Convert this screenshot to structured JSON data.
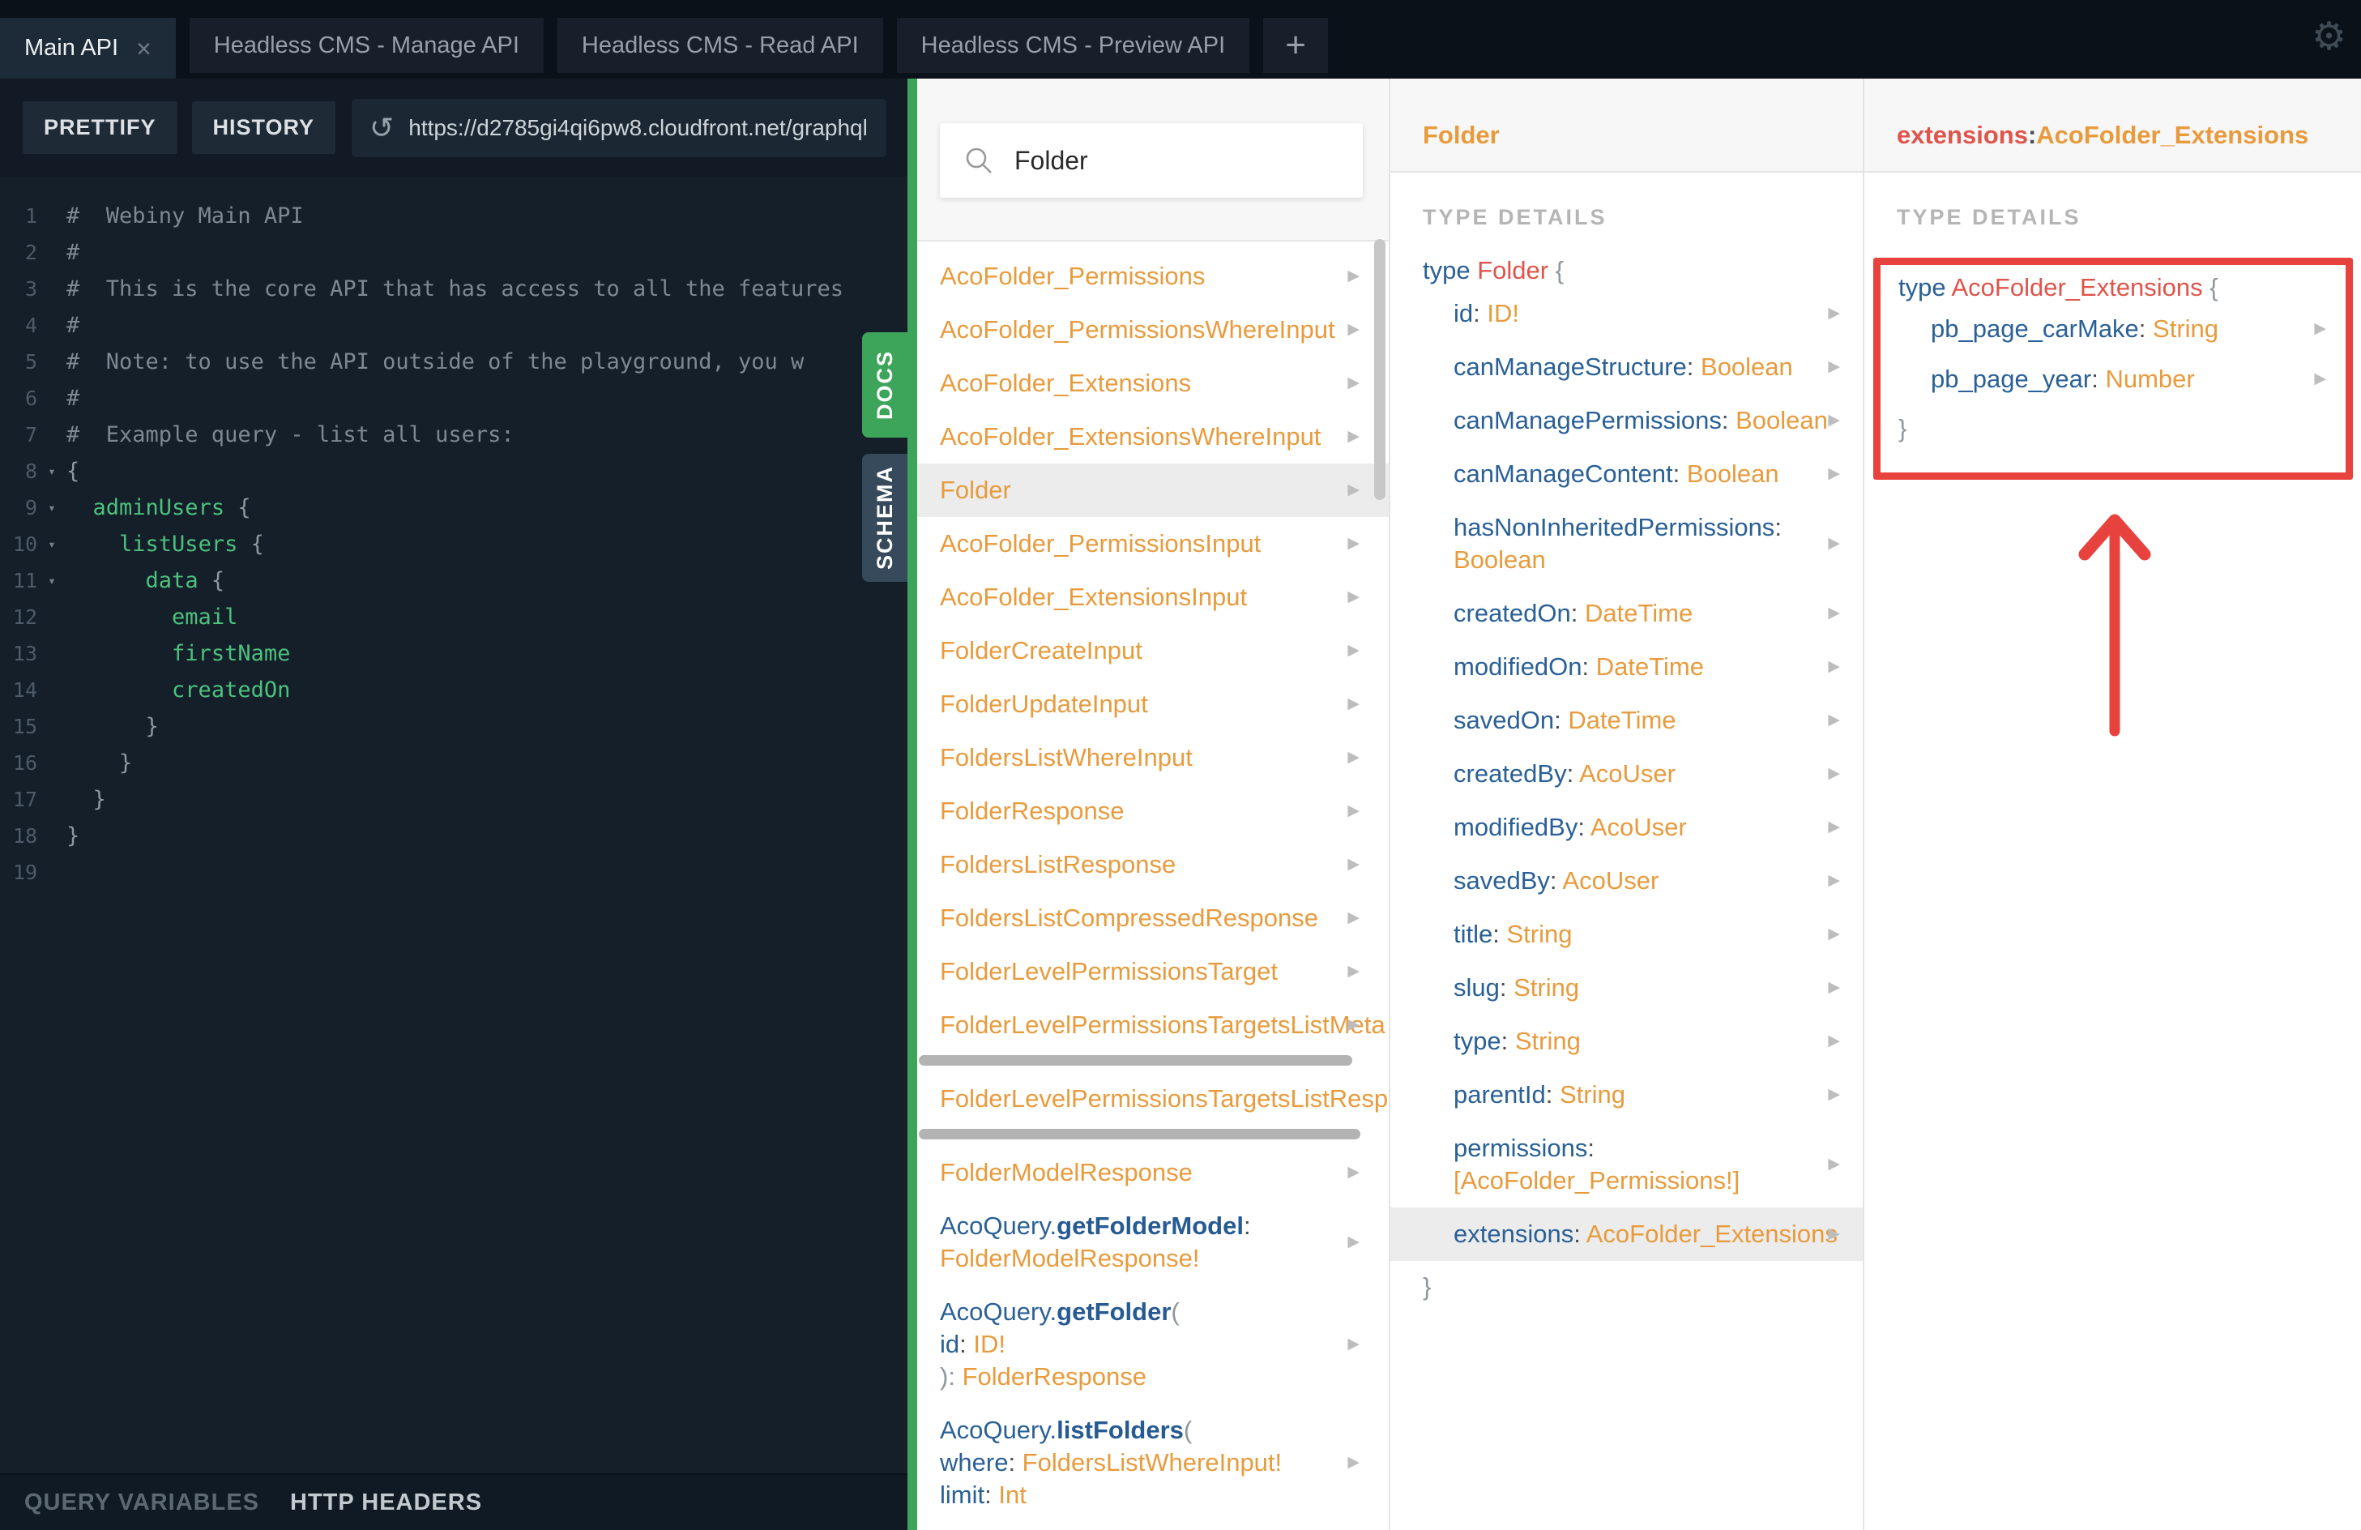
{
  "icons": {
    "gear": "⚙",
    "close": "×",
    "plus": "+",
    "refresh": "↺",
    "fold": "▾",
    "arrow": "▶",
    "search": "search"
  },
  "colors": {
    "accent_green": "#3da55a",
    "schema_tab": "#364a5b",
    "annotation_red": "#e8423e",
    "type_orange": "#e89b3d",
    "field_blue": "#2a6096",
    "type_red": "#df544b",
    "editor_green": "#4cc17e"
  },
  "tabs": {
    "items": [
      {
        "label": "Main API",
        "active": true,
        "closable": true
      },
      {
        "label": "Headless CMS - Manage API",
        "active": false,
        "closable": false
      },
      {
        "label": "Headless CMS - Read API",
        "active": false,
        "closable": false
      },
      {
        "label": "Headless CMS - Preview API",
        "active": false,
        "closable": false
      }
    ],
    "add_label": "+"
  },
  "toolbar": {
    "prettify": "PRETTIFY",
    "history": "HISTORY",
    "url": "https://d2785gi4qi6pw8.cloudfront.net/graphql"
  },
  "side_tabs": {
    "docs": "DOCS",
    "schema": "SCHEMA"
  },
  "footer": {
    "query_variables": "QUERY VARIABLES",
    "http_headers": "HTTP HEADERS"
  },
  "search": {
    "value": "Folder"
  },
  "editor": {
    "lines": [
      {
        "n": "1",
        "fold": false,
        "seg": [
          {
            "t": "#  Webiny Main API",
            "c": "cm"
          }
        ]
      },
      {
        "n": "2",
        "fold": false,
        "seg": [
          {
            "t": "#",
            "c": "cm"
          }
        ]
      },
      {
        "n": "3",
        "fold": false,
        "seg": [
          {
            "t": "#  This is the core API that has access to all the features",
            "c": "cm"
          }
        ]
      },
      {
        "n": "4",
        "fold": false,
        "seg": [
          {
            "t": "#",
            "c": "cm"
          }
        ]
      },
      {
        "n": "5",
        "fold": false,
        "seg": [
          {
            "t": "#  Note: to use the API outside of the playground, you w",
            "c": "cm"
          }
        ]
      },
      {
        "n": "6",
        "fold": false,
        "seg": [
          {
            "t": "#",
            "c": "cm"
          }
        ]
      },
      {
        "n": "7",
        "fold": false,
        "seg": [
          {
            "t": "#  Example query - list all users:",
            "c": "cm"
          }
        ]
      },
      {
        "n": "8",
        "fold": true,
        "seg": [
          {
            "t": "{",
            "c": "pn"
          }
        ]
      },
      {
        "n": "9",
        "fold": true,
        "seg": [
          {
            "t": "  ",
            "c": "pn"
          },
          {
            "t": "adminUsers ",
            "c": "gn"
          },
          {
            "t": "{",
            "c": "pn"
          }
        ]
      },
      {
        "n": "10",
        "fold": true,
        "seg": [
          {
            "t": "    ",
            "c": "pn"
          },
          {
            "t": "listUsers ",
            "c": "gn"
          },
          {
            "t": "{",
            "c": "pn"
          }
        ]
      },
      {
        "n": "11",
        "fold": true,
        "seg": [
          {
            "t": "      ",
            "c": "pn"
          },
          {
            "t": "data ",
            "c": "gn"
          },
          {
            "t": "{",
            "c": "pn"
          }
        ]
      },
      {
        "n": "12",
        "fold": false,
        "seg": [
          {
            "t": "        ",
            "c": "pn"
          },
          {
            "t": "email",
            "c": "gn"
          }
        ]
      },
      {
        "n": "13",
        "fold": false,
        "seg": [
          {
            "t": "        ",
            "c": "pn"
          },
          {
            "t": "firstName",
            "c": "gn"
          }
        ]
      },
      {
        "n": "14",
        "fold": false,
        "seg": [
          {
            "t": "        ",
            "c": "pn"
          },
          {
            "t": "createdOn",
            "c": "gn"
          }
        ]
      },
      {
        "n": "15",
        "fold": false,
        "seg": [
          {
            "t": "      }",
            "c": "pn"
          }
        ]
      },
      {
        "n": "16",
        "fold": false,
        "seg": [
          {
            "t": "    }",
            "c": "pn"
          }
        ]
      },
      {
        "n": "17",
        "fold": false,
        "seg": [
          {
            "t": "  }",
            "c": "pn"
          }
        ]
      },
      {
        "n": "18",
        "fold": false,
        "seg": [
          {
            "t": "}",
            "c": "pn"
          }
        ]
      },
      {
        "n": "19",
        "fold": false,
        "seg": []
      }
    ]
  },
  "docs_list": {
    "items": [
      {
        "lines": [
          [
            {
              "t": "AcoFolder_Permissions",
              "c": "o"
            }
          ]
        ],
        "arrow": true,
        "selected": false
      },
      {
        "lines": [
          [
            {
              "t": "AcoFolder_PermissionsWhereInput",
              "c": "o"
            }
          ]
        ],
        "arrow": true,
        "selected": false
      },
      {
        "lines": [
          [
            {
              "t": "AcoFolder_Extensions",
              "c": "o"
            }
          ]
        ],
        "arrow": true,
        "selected": false
      },
      {
        "lines": [
          [
            {
              "t": "AcoFolder_ExtensionsWhereInput",
              "c": "o"
            }
          ]
        ],
        "arrow": true,
        "selected": false
      },
      {
        "lines": [
          [
            {
              "t": "Folder",
              "c": "o"
            }
          ]
        ],
        "arrow": true,
        "selected": true
      },
      {
        "lines": [
          [
            {
              "t": "AcoFolder_PermissionsInput",
              "c": "o"
            }
          ]
        ],
        "arrow": true,
        "selected": false
      },
      {
        "lines": [
          [
            {
              "t": "AcoFolder_ExtensionsInput",
              "c": "o"
            }
          ]
        ],
        "arrow": true,
        "selected": false
      },
      {
        "lines": [
          [
            {
              "t": "FolderCreateInput",
              "c": "o"
            }
          ]
        ],
        "arrow": true,
        "selected": false
      },
      {
        "lines": [
          [
            {
              "t": "FolderUpdateInput",
              "c": "o"
            }
          ]
        ],
        "arrow": true,
        "selected": false
      },
      {
        "lines": [
          [
            {
              "t": "FoldersListWhereInput",
              "c": "o"
            }
          ]
        ],
        "arrow": true,
        "selected": false
      },
      {
        "lines": [
          [
            {
              "t": "FolderResponse",
              "c": "o"
            }
          ]
        ],
        "arrow": true,
        "selected": false
      },
      {
        "lines": [
          [
            {
              "t": "FoldersListResponse",
              "c": "o"
            }
          ]
        ],
        "arrow": true,
        "selected": false
      },
      {
        "lines": [
          [
            {
              "t": "FoldersListCompressedResponse",
              "c": "o"
            }
          ]
        ],
        "arrow": true,
        "selected": false
      },
      {
        "lines": [
          [
            {
              "t": "FolderLevelPermissionsTarget",
              "c": "o"
            }
          ]
        ],
        "arrow": true,
        "selected": false
      },
      {
        "lines": [
          [
            {
              "t": "FolderLevelPermissionsTargetsListMeta",
              "c": "o"
            }
          ]
        ],
        "arrow": true,
        "selected": false,
        "hscroll": 535
      },
      {
        "lines": [
          [
            {
              "t": "FolderLevelPermissionsTargetsListResponse",
              "c": "o"
            }
          ]
        ],
        "arrow": false,
        "selected": false,
        "hscroll": 545
      },
      {
        "lines": [
          [
            {
              "t": "FolderModelResponse",
              "c": "o"
            }
          ]
        ],
        "arrow": true,
        "selected": false
      },
      {
        "lines": [
          [
            {
              "t": "AcoQuery.",
              "c": "b"
            },
            {
              "t": "getFolderModel",
              "c": "bb"
            },
            {
              "t": ":",
              "c": "d"
            }
          ],
          [
            {
              "t": "FolderModelResponse!",
              "c": "o"
            }
          ]
        ],
        "arrow": true,
        "selected": false
      },
      {
        "lines": [
          [
            {
              "t": "AcoQuery.",
              "c": "b"
            },
            {
              "t": "getFolder",
              "c": "bb"
            },
            {
              "t": "(",
              "c": "pn"
            }
          ],
          [
            {
              "t": "   ",
              "c": "pn"
            },
            {
              "t": "id",
              "c": "b"
            },
            {
              "t": ": ",
              "c": "d"
            },
            {
              "t": "ID!",
              "c": "o"
            }
          ],
          [
            {
              "t": "): ",
              "c": "pn"
            },
            {
              "t": "FolderResponse",
              "c": "o"
            }
          ]
        ],
        "arrow": true,
        "selected": false
      },
      {
        "lines": [
          [
            {
              "t": "AcoQuery.",
              "c": "b"
            },
            {
              "t": "listFolders",
              "c": "bb"
            },
            {
              "t": "(",
              "c": "pn"
            }
          ],
          [
            {
              "t": "   ",
              "c": "pn"
            },
            {
              "t": "where",
              "c": "b"
            },
            {
              "t": ": ",
              "c": "d"
            },
            {
              "t": "FoldersListWhereInput!",
              "c": "o"
            }
          ],
          [
            {
              "t": "   ",
              "c": "pn"
            },
            {
              "t": "limit",
              "c": "b"
            },
            {
              "t": ": ",
              "c": "d"
            },
            {
              "t": "Int",
              "c": "o"
            }
          ]
        ],
        "arrow": true,
        "selected": false
      }
    ]
  },
  "type_panel": {
    "title": "Folder",
    "section_label": "TYPE DETAILS",
    "open_seg": [
      {
        "t": "type ",
        "c": "b"
      },
      {
        "t": "Folder ",
        "c": "r"
      },
      {
        "t": "{",
        "c": "pn"
      }
    ],
    "fields": [
      {
        "seg": [
          {
            "t": "id",
            "c": "b"
          },
          {
            "t": ": ",
            "c": "d"
          },
          {
            "t": "ID!",
            "c": "o"
          }
        ],
        "arrow": true,
        "wrap": false,
        "selected": false
      },
      {
        "seg": [
          {
            "t": "canManageStructure",
            "c": "b"
          },
          {
            "t": ": ",
            "c": "d"
          },
          {
            "t": "Boolean",
            "c": "o"
          }
        ],
        "arrow": true,
        "wrap": false,
        "selected": false
      },
      {
        "seg": [
          {
            "t": "canManagePermissions",
            "c": "b"
          },
          {
            "t": ": ",
            "c": "d"
          },
          {
            "t": "Boolean",
            "c": "o"
          }
        ],
        "arrow": true,
        "wrap": false,
        "selected": false
      },
      {
        "seg": [
          {
            "t": "canManageContent",
            "c": "b"
          },
          {
            "t": ": ",
            "c": "d"
          },
          {
            "t": "Boolean",
            "c": "o"
          }
        ],
        "arrow": true,
        "wrap": false,
        "selected": false
      },
      {
        "seg": [
          {
            "t": "hasNonInheritedPermissions",
            "c": "b"
          },
          {
            "t": ":",
            "c": "d"
          },
          {
            "t": "Boolean",
            "c": "o"
          }
        ],
        "arrow": true,
        "wrap": true,
        "selected": false
      },
      {
        "seg": [
          {
            "t": "createdOn",
            "c": "b"
          },
          {
            "t": ": ",
            "c": "d"
          },
          {
            "t": "DateTime",
            "c": "o"
          }
        ],
        "arrow": true,
        "wrap": false,
        "selected": false
      },
      {
        "seg": [
          {
            "t": "modifiedOn",
            "c": "b"
          },
          {
            "t": ": ",
            "c": "d"
          },
          {
            "t": "DateTime",
            "c": "o"
          }
        ],
        "arrow": true,
        "wrap": false,
        "selected": false
      },
      {
        "seg": [
          {
            "t": "savedOn",
            "c": "b"
          },
          {
            "t": ": ",
            "c": "d"
          },
          {
            "t": "DateTime",
            "c": "o"
          }
        ],
        "arrow": true,
        "wrap": false,
        "selected": false
      },
      {
        "seg": [
          {
            "t": "createdBy",
            "c": "b"
          },
          {
            "t": ": ",
            "c": "d"
          },
          {
            "t": "AcoUser",
            "c": "o"
          }
        ],
        "arrow": true,
        "wrap": false,
        "selected": false
      },
      {
        "seg": [
          {
            "t": "modifiedBy",
            "c": "b"
          },
          {
            "t": ": ",
            "c": "d"
          },
          {
            "t": "AcoUser",
            "c": "o"
          }
        ],
        "arrow": true,
        "wrap": false,
        "selected": false
      },
      {
        "seg": [
          {
            "t": "savedBy",
            "c": "b"
          },
          {
            "t": ": ",
            "c": "d"
          },
          {
            "t": "AcoUser",
            "c": "o"
          }
        ],
        "arrow": true,
        "wrap": false,
        "selected": false
      },
      {
        "seg": [
          {
            "t": "title",
            "c": "b"
          },
          {
            "t": ": ",
            "c": "d"
          },
          {
            "t": "String",
            "c": "o"
          }
        ],
        "arrow": true,
        "wrap": false,
        "selected": false
      },
      {
        "seg": [
          {
            "t": "slug",
            "c": "b"
          },
          {
            "t": ": ",
            "c": "d"
          },
          {
            "t": "String",
            "c": "o"
          }
        ],
        "arrow": true,
        "wrap": false,
        "selected": false
      },
      {
        "seg": [
          {
            "t": "type",
            "c": "b"
          },
          {
            "t": ": ",
            "c": "d"
          },
          {
            "t": "String",
            "c": "o"
          }
        ],
        "arrow": true,
        "wrap": false,
        "selected": false
      },
      {
        "seg": [
          {
            "t": "parentId",
            "c": "b"
          },
          {
            "t": ": ",
            "c": "d"
          },
          {
            "t": "String",
            "c": "o"
          }
        ],
        "arrow": true,
        "wrap": false,
        "selected": false
      },
      {
        "seg": [
          {
            "t": "permissions",
            "c": "b"
          },
          {
            "t": ":",
            "c": "d"
          },
          {
            "t": "[AcoFolder_Permissions!]",
            "c": "o"
          }
        ],
        "arrow": true,
        "wrap": true,
        "selected": false
      },
      {
        "seg": [
          {
            "t": "extensions",
            "c": "b"
          },
          {
            "t": ": ",
            "c": "d"
          },
          {
            "t": "AcoFolder_Extensions",
            "c": "o"
          }
        ],
        "arrow": true,
        "wrap": false,
        "selected": true
      }
    ],
    "close": "}"
  },
  "extensions_panel": {
    "title_seg": [
      {
        "t": "extensions",
        "c": "r"
      },
      {
        "t": ": ",
        "c": "d"
      },
      {
        "t": "AcoFolder_Extensions",
        "c": "o"
      }
    ],
    "section_label": "TYPE DETAILS",
    "open_seg": [
      {
        "t": "type ",
        "c": "b"
      },
      {
        "t": "AcoFolder_Extensions ",
        "c": "r"
      },
      {
        "t": "{",
        "c": "pn"
      }
    ],
    "fields": [
      {
        "seg": [
          {
            "t": "pb_page_carMake",
            "c": "b"
          },
          {
            "t": ": ",
            "c": "d"
          },
          {
            "t": "String",
            "c": "o"
          }
        ],
        "arrow": true,
        "wrap": false,
        "selected": false
      },
      {
        "seg": [
          {
            "t": "pb_page_year",
            "c": "b"
          },
          {
            "t": ": ",
            "c": "d"
          },
          {
            "t": "Number",
            "c": "o"
          }
        ],
        "arrow": true,
        "wrap": false,
        "selected": false
      }
    ],
    "close": "}"
  }
}
